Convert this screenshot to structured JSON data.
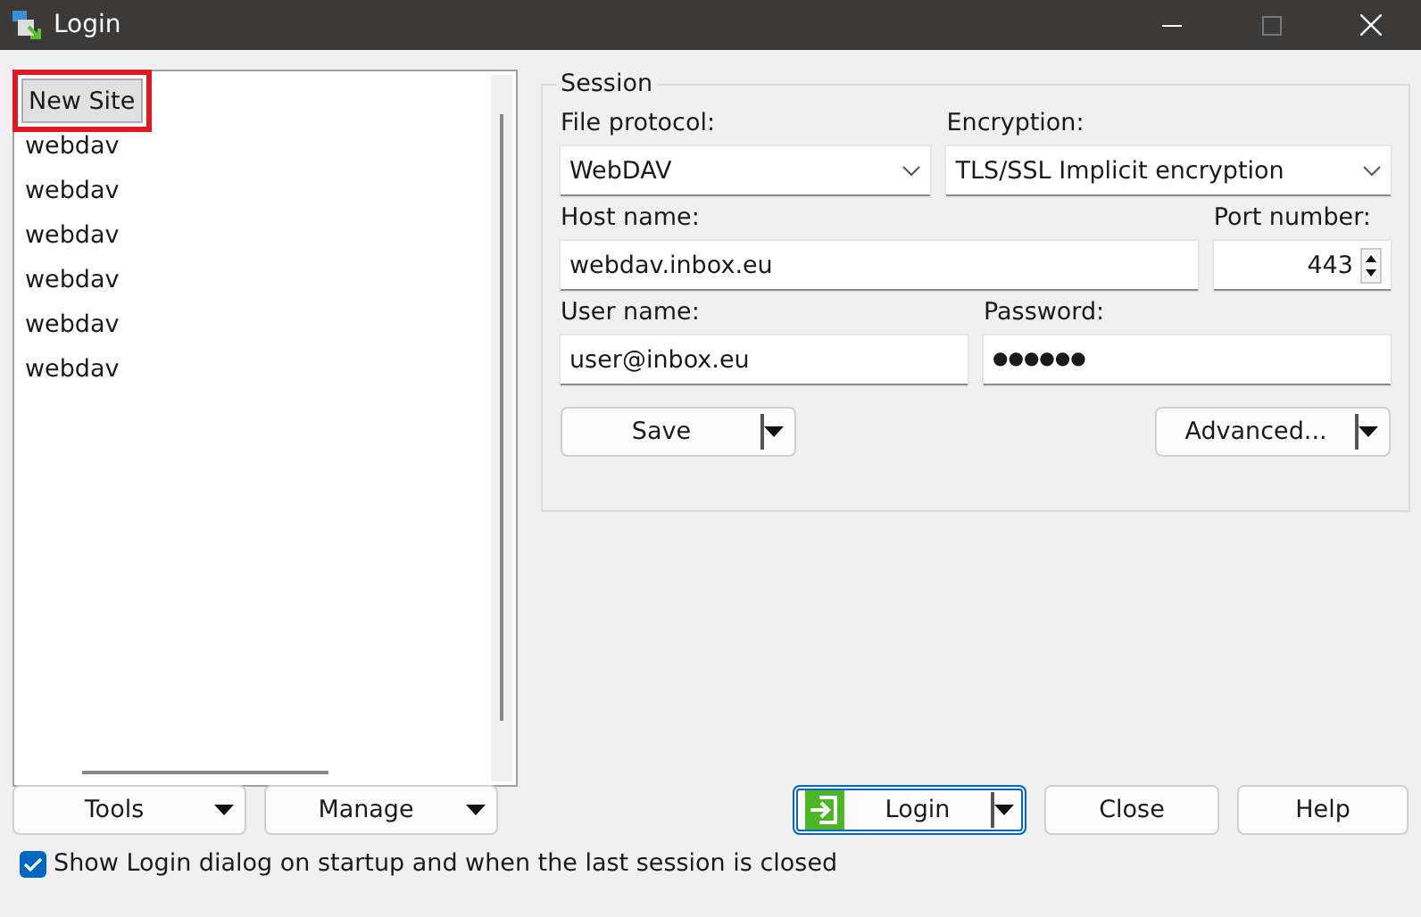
{
  "window": {
    "title": "Login"
  },
  "sites": [
    {
      "label": "New Site",
      "selected": true
    },
    {
      "label": "webdav",
      "selected": false
    },
    {
      "label": "webdav",
      "selected": false
    },
    {
      "label": "webdav",
      "selected": false
    },
    {
      "label": "webdav",
      "selected": false
    },
    {
      "label": "webdav",
      "selected": false
    },
    {
      "label": "webdav",
      "selected": false
    }
  ],
  "session": {
    "title": "Session",
    "file_protocol": {
      "label": "File protocol:",
      "value": "WebDAV"
    },
    "encryption": {
      "label": "Encryption:",
      "value": "TLS/SSL Implicit encryption"
    },
    "host_name": {
      "label": "Host name:",
      "value": "webdav.inbox.eu"
    },
    "port_number": {
      "label": "Port number:",
      "value": "443"
    },
    "user_name": {
      "label": "User name:",
      "value": "user@inbox.eu"
    },
    "password": {
      "label": "Password:",
      "value": "●●●●●●"
    },
    "save_button": "Save",
    "advanced_button": "Advanced..."
  },
  "buttons": {
    "tools": "Tools",
    "manage": "Manage",
    "login": "Login",
    "close": "Close",
    "help": "Help"
  },
  "show_login_dialog": {
    "label": "Show Login dialog on startup and when the last session is closed",
    "checked": true
  }
}
